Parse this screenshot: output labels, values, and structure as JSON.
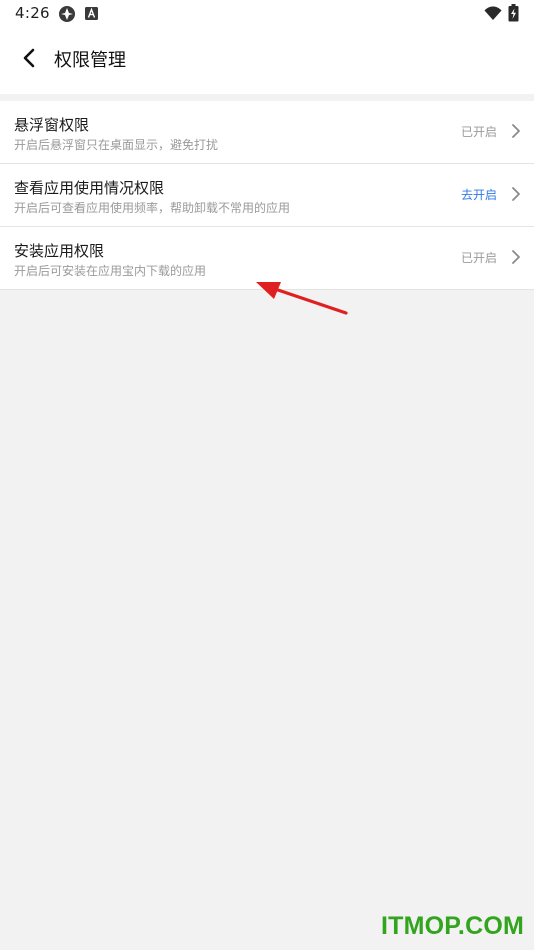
{
  "status_bar": {
    "time": "4:26",
    "icons": [
      "app-notification-icon",
      "text-notification-icon",
      "wifi-icon",
      "battery-charging-icon"
    ]
  },
  "header": {
    "title": "权限管理",
    "back_icon": "back-chevron-icon"
  },
  "permissions": [
    {
      "title": "悬浮窗权限",
      "subtitle": "开启后悬浮窗只在桌面显示，避免打扰",
      "status": "已开启"
    },
    {
      "title": "查看应用使用情况权限",
      "subtitle": "开启后可查看应用使用频率，帮助卸载不常用的应用",
      "status": "去开启"
    },
    {
      "title": "安装应用权限",
      "subtitle": "开启后可安装在应用宝内下载的应用",
      "status": "已开启"
    }
  ],
  "colors": {
    "background": "#f2f2f2",
    "surface": "#ffffff",
    "action_blue": "#2f7ae5",
    "secondary_text": "#9a9a9a",
    "annotation_red": "#e02020",
    "watermark_green": "#32a41d"
  },
  "watermark": "ITMOP.COM"
}
